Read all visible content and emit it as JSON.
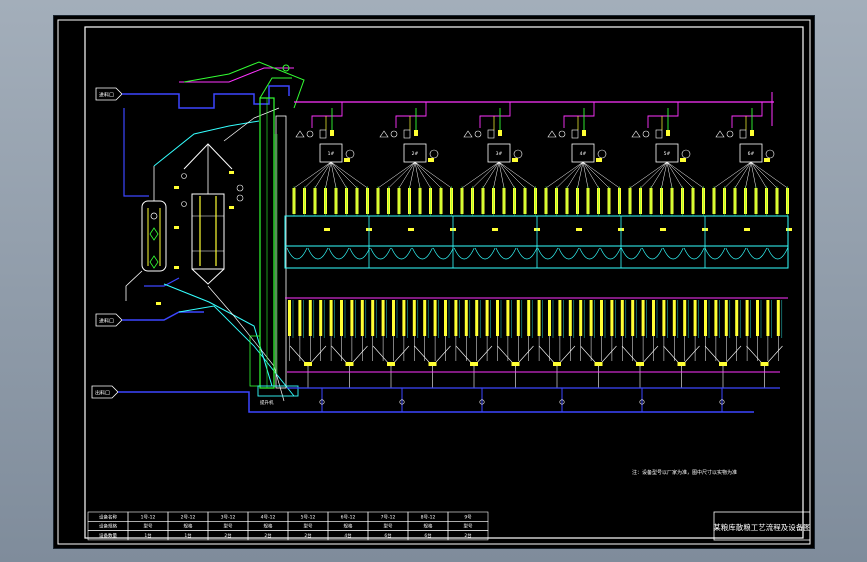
{
  "drawing": {
    "title": "某粮库散粮工艺流程及设备图",
    "note": "注：设备型号以厂家为准，图中尺寸以实物为准",
    "colors": {
      "background": "#000000",
      "frame": "#ffffff",
      "pipe_blue": "#3c46ff",
      "pipe_magenta": "#ff33ff",
      "cyan": "#33ffff",
      "yellow": "#ffff33",
      "green": "#33ff33",
      "red": "#ff3333"
    }
  },
  "labels": {
    "inlet_top": "进料口",
    "inlet_mid": "进料口",
    "inlet_bottom": "出料口",
    "tower_label": "提升机"
  },
  "units": {
    "count": 6,
    "head_labels": [
      "1#",
      "2#",
      "3#",
      "4#",
      "5#",
      "6#"
    ]
  },
  "table": {
    "rows": [
      [
        "设备名称",
        "1号-12",
        "2号-12",
        "3号-12",
        "4号-12",
        "5号-12",
        "6号-12",
        "7号-12",
        "8号-12",
        "9号"
      ],
      [
        "设备规格",
        "型号",
        "规格",
        "型号",
        "规格",
        "型号",
        "规格",
        "型号",
        "规格",
        "型号"
      ],
      [
        "设备数量",
        "1台",
        "1台",
        "2台",
        "2台",
        "2台",
        "4台",
        "6台",
        "6台",
        "2台"
      ]
    ]
  }
}
